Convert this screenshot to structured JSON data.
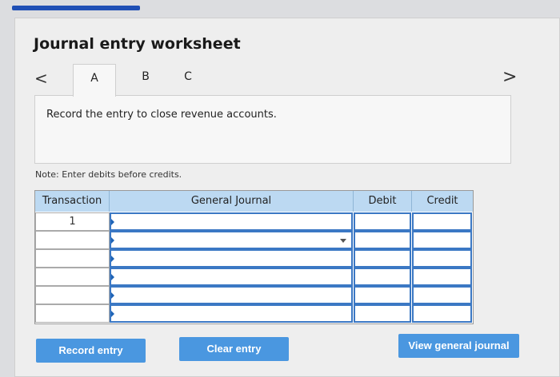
{
  "header": {
    "title": "Journal entry worksheet"
  },
  "nav": {
    "prev_glyph": "<",
    "next_glyph": ">"
  },
  "tabs": [
    {
      "label": "A",
      "active": true
    },
    {
      "label": "B",
      "active": false
    },
    {
      "label": "C",
      "active": false
    }
  ],
  "prompt": {
    "text": "Record the entry to close revenue accounts."
  },
  "note": {
    "text": "Note: Enter debits before credits."
  },
  "table": {
    "columns": [
      "Transaction",
      "General Journal",
      "Debit",
      "Credit"
    ],
    "rows": [
      {
        "transaction": "1",
        "account": "",
        "debit": "",
        "credit": ""
      },
      {
        "transaction": "",
        "account": "",
        "debit": "",
        "credit": ""
      },
      {
        "transaction": "",
        "account": "",
        "debit": "",
        "credit": ""
      },
      {
        "transaction": "",
        "account": "",
        "debit": "",
        "credit": ""
      },
      {
        "transaction": "",
        "account": "",
        "debit": "",
        "credit": ""
      },
      {
        "transaction": "",
        "account": "",
        "debit": "",
        "credit": ""
      }
    ]
  },
  "buttons": {
    "record": "Record entry",
    "clear": "Clear entry",
    "view": "View general journal"
  },
  "colors": {
    "accent": "#4a97e0",
    "header_fill": "#bcd9f2",
    "input_border": "#3b78c4",
    "progress_bar": "#1f4fb5"
  }
}
